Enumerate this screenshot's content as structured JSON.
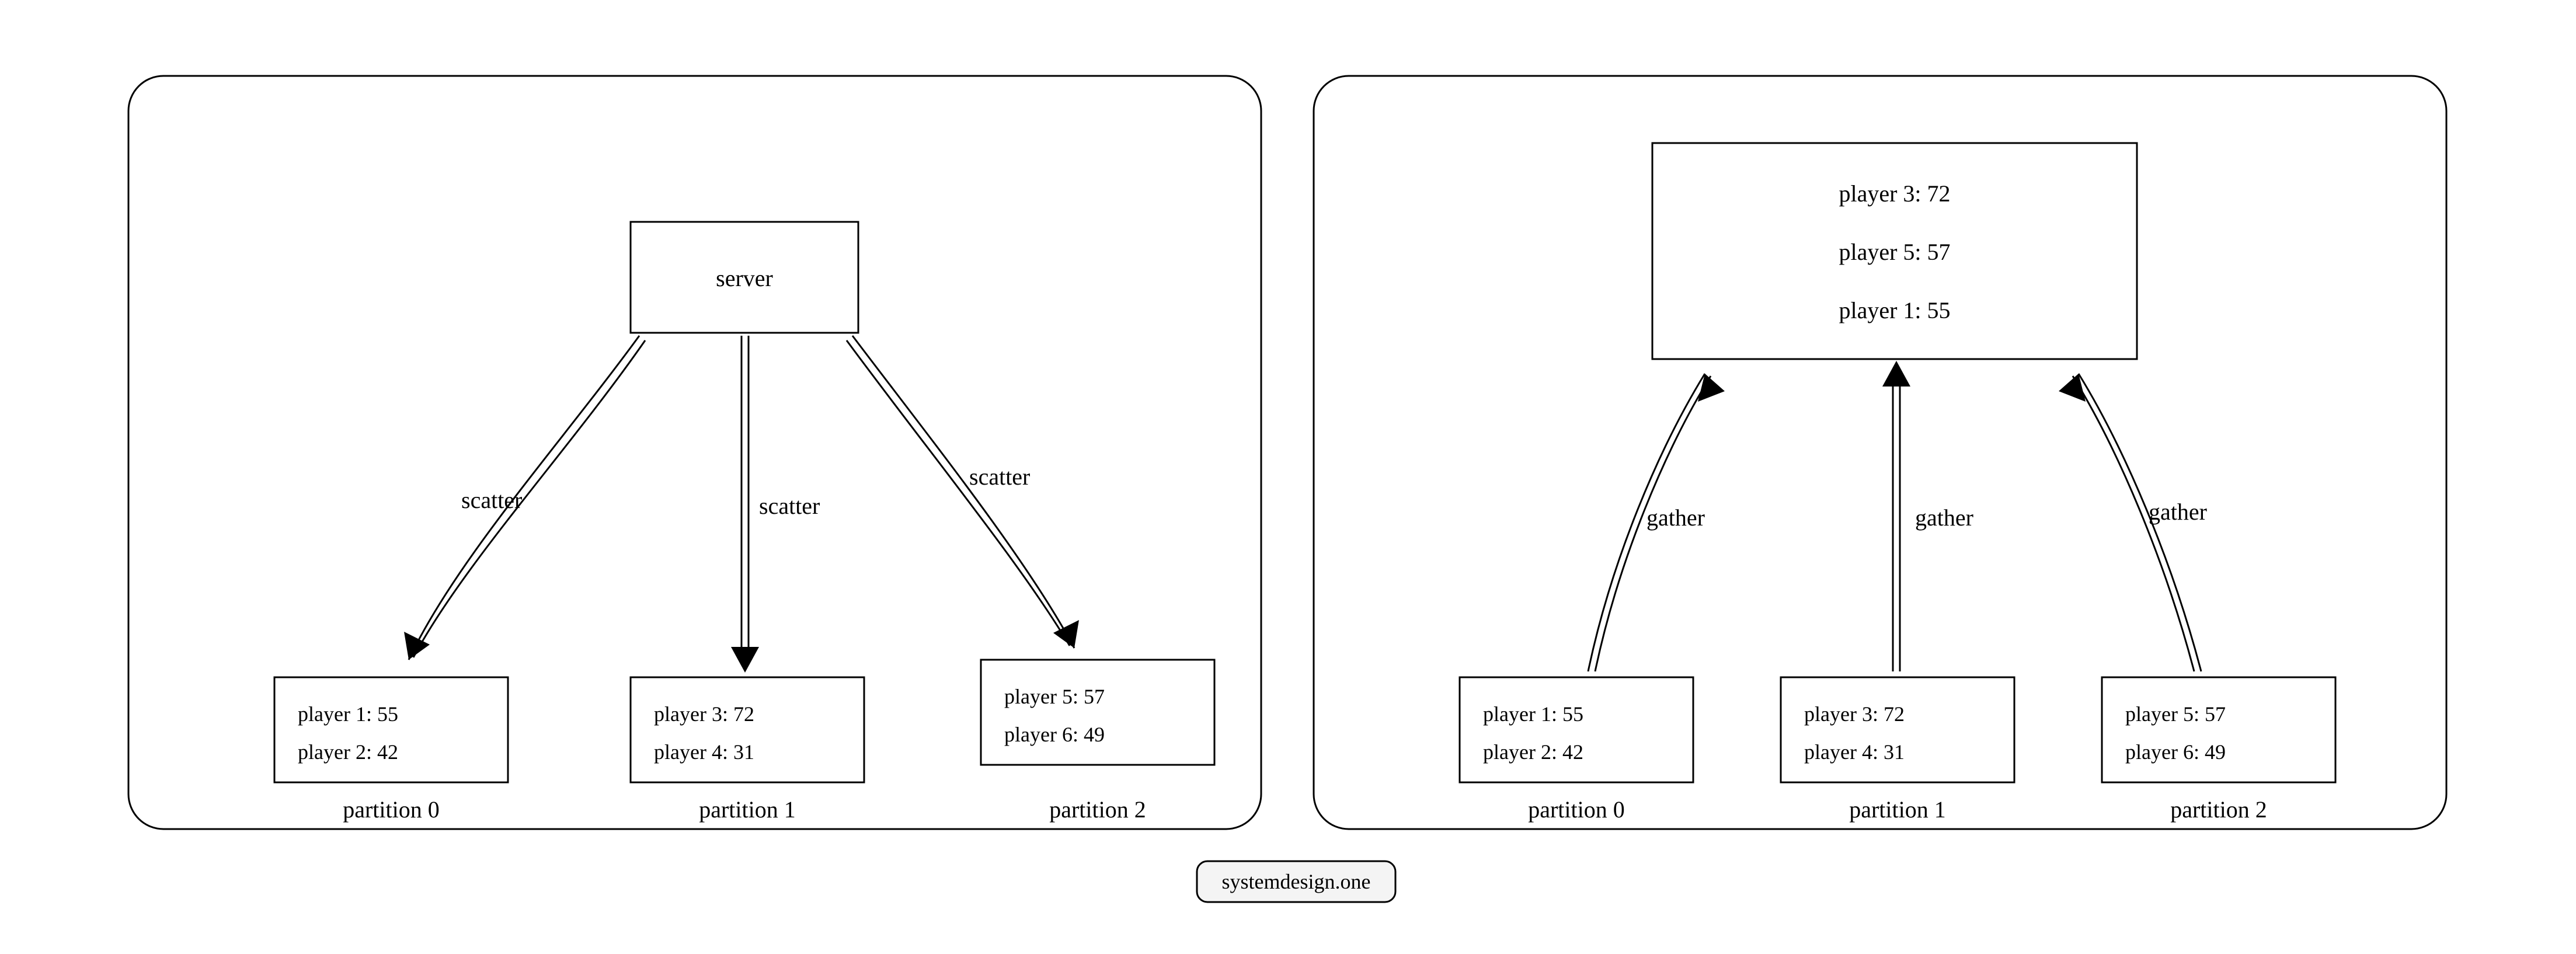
{
  "left": {
    "serverLabel": "server",
    "arrows": [
      "scatter",
      "scatter",
      "scatter"
    ],
    "partitions": [
      {
        "label": "partition 0",
        "lines": [
          "player 1: 55",
          "player 2: 42"
        ]
      },
      {
        "label": "partition 1",
        "lines": [
          "player 3: 72",
          "player 4: 31"
        ]
      },
      {
        "label": "partition 2",
        "lines": [
          "player 5: 57",
          "player 6: 49"
        ]
      }
    ]
  },
  "right": {
    "resultLines": [
      "player 3: 72",
      "player 5: 57",
      "player 1: 55"
    ],
    "arrows": [
      "gather",
      "gather",
      "gather"
    ],
    "partitions": [
      {
        "label": "partition 0",
        "lines": [
          "player 1: 55",
          "player 2: 42"
        ]
      },
      {
        "label": "partition 1",
        "lines": [
          "player 3: 72",
          "player 4: 31"
        ]
      },
      {
        "label": "partition 2",
        "lines": [
          "player 5: 57",
          "player 6: 49"
        ]
      }
    ]
  },
  "footer": "systemdesign.one"
}
